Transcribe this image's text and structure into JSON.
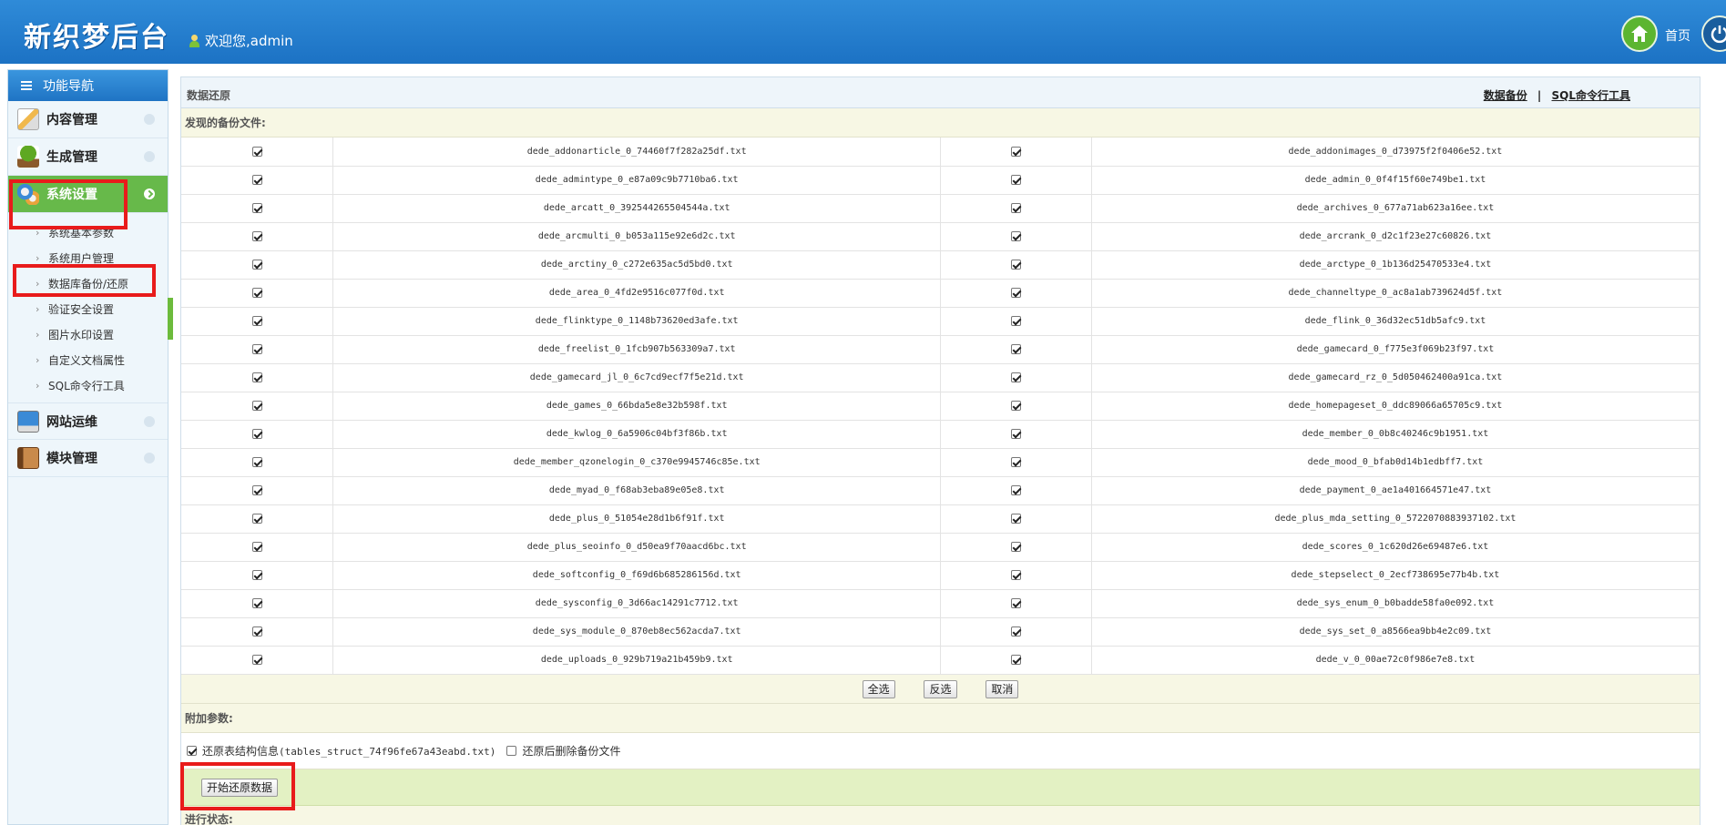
{
  "header": {
    "logo": "新织梦后台",
    "welcome": "欢迎您,admin",
    "home_label": "首页"
  },
  "sidebar": {
    "nav_title": "功能导航",
    "menus": [
      {
        "label": "内容管理",
        "icon": "edit-icon"
      },
      {
        "label": "生成管理",
        "icon": "tree-icon"
      },
      {
        "label": "系统设置",
        "icon": "gears-icon"
      }
    ],
    "sub_items": [
      "系统基本参数",
      "系统用户管理",
      "数据库备份/还原",
      "验证安全设置",
      "图片水印设置",
      "自定义文档属性",
      "SQL命令行工具"
    ],
    "menus_after": [
      {
        "label": "网站运维",
        "icon": "monitor-icon"
      },
      {
        "label": "模块管理",
        "icon": "book-icon"
      }
    ]
  },
  "main": {
    "title": "数据还原",
    "link_backup": "数据备份",
    "link_separator": "|",
    "link_sql": "SQL命令行工具",
    "found_label": "发现的备份文件:",
    "files": [
      [
        "dede_addonarticle_0_74460f7f282a25df.txt",
        "dede_addonimages_0_d73975f2f0406e52.txt"
      ],
      [
        "dede_admintype_0_e87a09c9b7710ba6.txt",
        "dede_admin_0_0f4f15f60e749be1.txt"
      ],
      [
        "dede_arcatt_0_392544265504544a.txt",
        "dede_archives_0_677a71ab623a16ee.txt"
      ],
      [
        "dede_arcmulti_0_b053a115e92e6d2c.txt",
        "dede_arcrank_0_d2c1f23e27c60826.txt"
      ],
      [
        "dede_arctiny_0_c272e635ac5d5bd0.txt",
        "dede_arctype_0_1b136d25470533e4.txt"
      ],
      [
        "dede_area_0_4fd2e9516c077f0d.txt",
        "dede_channeltype_0_ac8a1ab739624d5f.txt"
      ],
      [
        "dede_flinktype_0_1148b73620ed3afe.txt",
        "dede_flink_0_36d32ec51db5afc9.txt"
      ],
      [
        "dede_freelist_0_1fcb907b563309a7.txt",
        "dede_gamecard_0_f775e3f069b23f97.txt"
      ],
      [
        "dede_gamecard_jl_0_6c7cd9ecf7f5e21d.txt",
        "dede_gamecard_rz_0_5d050462400a91ca.txt"
      ],
      [
        "dede_games_0_66bda5e8e32b598f.txt",
        "dede_homepageset_0_ddc89066a65705c9.txt"
      ],
      [
        "dede_kwlog_0_6a5906c04bf3f86b.txt",
        "dede_member_0_0b8c40246c9b1951.txt"
      ],
      [
        "dede_member_qzonelogin_0_c370e9945746c85e.txt",
        "dede_mood_0_bfab0d14b1edbff7.txt"
      ],
      [
        "dede_myad_0_f68ab3eba89e05e8.txt",
        "dede_payment_0_ae1a401664571e47.txt"
      ],
      [
        "dede_plus_0_51054e28d1b6f91f.txt",
        "dede_plus_mda_setting_0_5722070883937102.txt"
      ],
      [
        "dede_plus_seoinfo_0_d50ea9f70aacd6bc.txt",
        "dede_scores_0_1c620d26e69487e6.txt"
      ],
      [
        "dede_softconfig_0_f69d6b685286156d.txt",
        "dede_stepselect_0_2ecf738695e77b4b.txt"
      ],
      [
        "dede_sysconfig_0_3d66ac14291c7712.txt",
        "dede_sys_enum_0_b0badde58fa0e092.txt"
      ],
      [
        "dede_sys_module_0_870eb8ec562acda7.txt",
        "dede_sys_set_0_a8566ea9bb4e2c09.txt"
      ],
      [
        "dede_uploads_0_929b719a21b459b9.txt",
        "dede_v_0_00ae72c0f986e7e8.txt"
      ]
    ],
    "btn_select_all": "全选",
    "btn_invert": "反选",
    "btn_cancel": "取消",
    "extra_label": "附加参数:",
    "opt_struct_label": "还原表结构信息",
    "opt_struct_file": "(tables_struct_74f96fe67a43eabd.txt)",
    "opt_delete_label": "还原后删除备份文件",
    "btn_start": "开始还原数据",
    "status_label": "进行状态:"
  }
}
